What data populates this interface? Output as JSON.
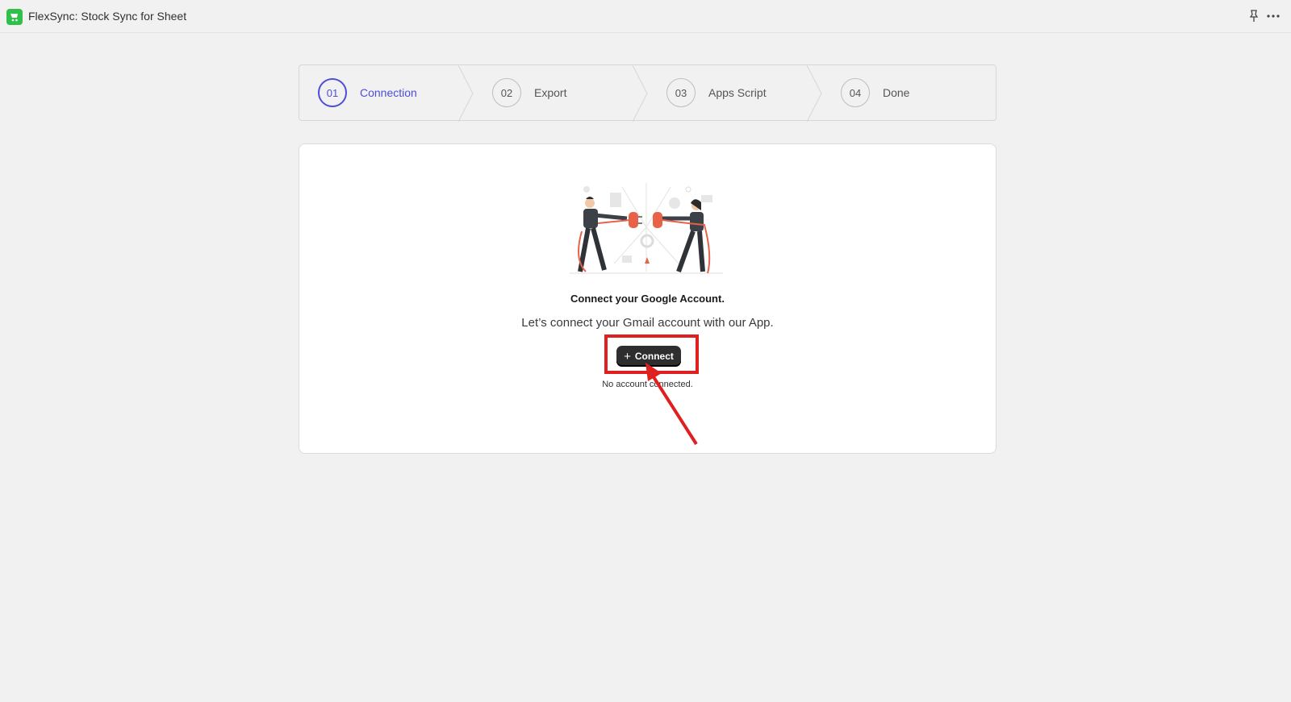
{
  "app": {
    "title": "FlexSync: Stock Sync for Sheet"
  },
  "steps": [
    {
      "number": "01",
      "label": "Connection",
      "active": true
    },
    {
      "number": "02",
      "label": "Export",
      "active": false
    },
    {
      "number": "03",
      "label": "Apps Script",
      "active": false
    },
    {
      "number": "04",
      "label": "Done",
      "active": false
    }
  ],
  "card": {
    "heading": "Connect your Google Account.",
    "subtext": "Let’s connect your Gmail account with our App.",
    "connect_button": "Connect",
    "status": "No account connected."
  },
  "colors": {
    "accent": "#4d4dd8",
    "annotation_red": "#e02020",
    "button_dark": "#2e2e2e",
    "app_icon": "#2fbf4b"
  },
  "icons": [
    "app-icon",
    "pin-icon",
    "more-icon",
    "plus-icon"
  ]
}
